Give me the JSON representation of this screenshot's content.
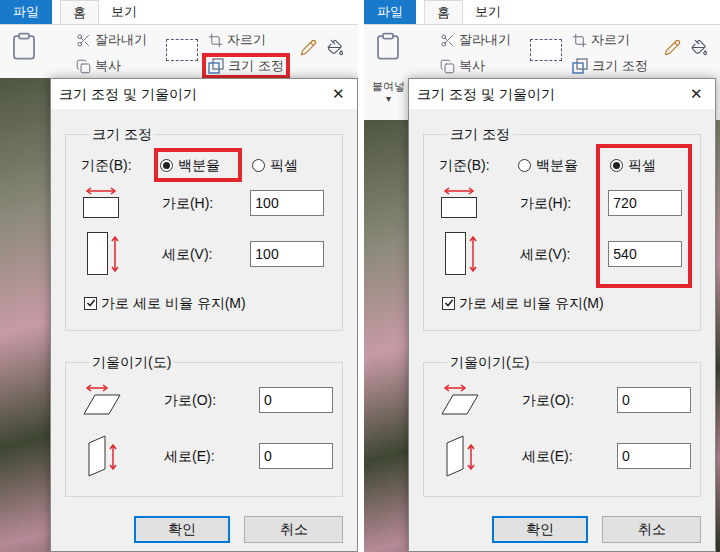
{
  "panels": [
    {
      "tabs": [
        {
          "label": "파일",
          "kind": "file",
          "selected": false
        },
        {
          "label": "홈",
          "kind": "tab",
          "selected": true
        },
        {
          "label": "보기",
          "kind": "tab",
          "selected": false
        }
      ],
      "ribbon": {
        "items": [
          {
            "label": "잘라내기",
            "kind": "cut",
            "highlighted": false
          },
          {
            "label": "복사",
            "kind": "copy",
            "highlighted": false
          },
          {
            "label": "자르기",
            "kind": "crop",
            "highlighted": false
          },
          {
            "label": "크기 조정",
            "kind": "resize",
            "highlighted": true
          }
        ]
      },
      "dialog": {
        "title": "크기 조정 및 기울이기",
        "close": "✕",
        "resize": {
          "title": "크기 조정",
          "basis_label": "기준(B):",
          "options": [
            {
              "label": "백분율",
              "selected": true,
              "highlighted": true
            },
            {
              "label": "픽셀",
              "selected": false,
              "highlighted": false
            }
          ],
          "fields": [
            {
              "label": "가로(H):",
              "value": "100"
            },
            {
              "label": "세로(V):",
              "value": "100"
            }
          ],
          "fields_highlighted": false,
          "keep_ratio": {
            "label": "가로 세로 비율 유지(M)",
            "checked": true
          }
        },
        "skew": {
          "title": "기울이기(도)",
          "fields": [
            {
              "label": "가로(O):",
              "value": "0"
            },
            {
              "label": "세로(E):",
              "value": "0"
            }
          ]
        },
        "buttons": [
          {
            "label": "확인",
            "default": true
          },
          {
            "label": "취소",
            "default": false
          }
        ]
      }
    },
    {
      "tabs": [
        {
          "label": "파일",
          "kind": "file",
          "selected": false
        },
        {
          "label": "홈",
          "kind": "tab",
          "selected": true
        },
        {
          "label": "보기",
          "kind": "tab",
          "selected": false
        }
      ],
      "ribbon": {
        "paste": {
          "label": "붙여넣",
          "caret": "▾"
        },
        "items": [
          {
            "label": "잘라내기",
            "kind": "cut",
            "highlighted": false
          },
          {
            "label": "복사",
            "kind": "copy",
            "highlighted": false
          },
          {
            "label": "자르기",
            "kind": "crop",
            "highlighted": false
          },
          {
            "label": "크기 조정",
            "kind": "resize",
            "highlighted": false
          }
        ]
      },
      "dialog": {
        "title": "크기 조정 및 기울이기",
        "close": "✕",
        "resize": {
          "title": "크기 조정",
          "basis_label": "기준(B):",
          "options": [
            {
              "label": "백분율",
              "selected": false,
              "highlighted": false
            },
            {
              "label": "픽셀",
              "selected": true,
              "highlighted": false
            }
          ],
          "fields": [
            {
              "label": "가로(H):",
              "value": "720"
            },
            {
              "label": "세로(V):",
              "value": "540"
            }
          ],
          "fields_highlighted": true,
          "keep_ratio": {
            "label": "가로 세로 비율 유지(M)",
            "checked": true
          }
        },
        "skew": {
          "title": "기울이기(도)",
          "fields": [
            {
              "label": "가로(O):",
              "value": "0"
            },
            {
              "label": "세로(E):",
              "value": "0"
            }
          ]
        },
        "buttons": [
          {
            "label": "확인",
            "default": true
          },
          {
            "label": "취소",
            "default": false
          }
        ]
      }
    }
  ]
}
